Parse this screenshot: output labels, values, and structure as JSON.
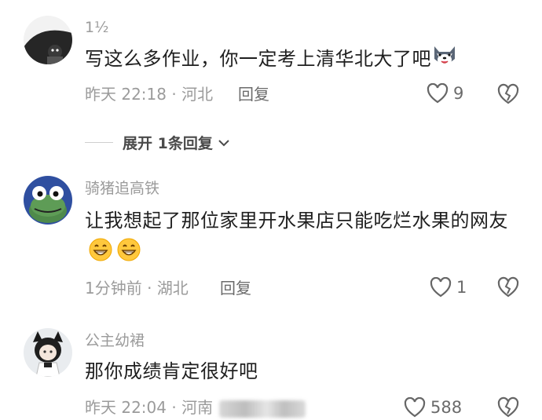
{
  "comments": [
    {
      "username": "1½",
      "text": "写这么多作业，你一定考上清华北大了吧",
      "emoji": "husky-dog-emoji",
      "time": "昨天 22:18",
      "location": "河北",
      "reply_label": "回复",
      "likes": "9"
    },
    {
      "username": "骑猪追高铁",
      "text": "让我想起了那位家里开水果店只能吃烂水果的网友",
      "emoji": "grin-emoji",
      "time": "1分钟前",
      "location": "湖北",
      "reply_label": "回复",
      "likes": "1"
    },
    {
      "username": "公主幼裙",
      "text": "那你成绩肯定很好吧",
      "time": "昨天 22:04",
      "location": "河南",
      "likes": "588"
    }
  ],
  "expand_replies": {
    "label": "展开 1条回复"
  },
  "icons": {
    "like": "heart-outline-icon",
    "dislike": "broken-heart-icon",
    "chevron": "chevron-down-icon"
  }
}
